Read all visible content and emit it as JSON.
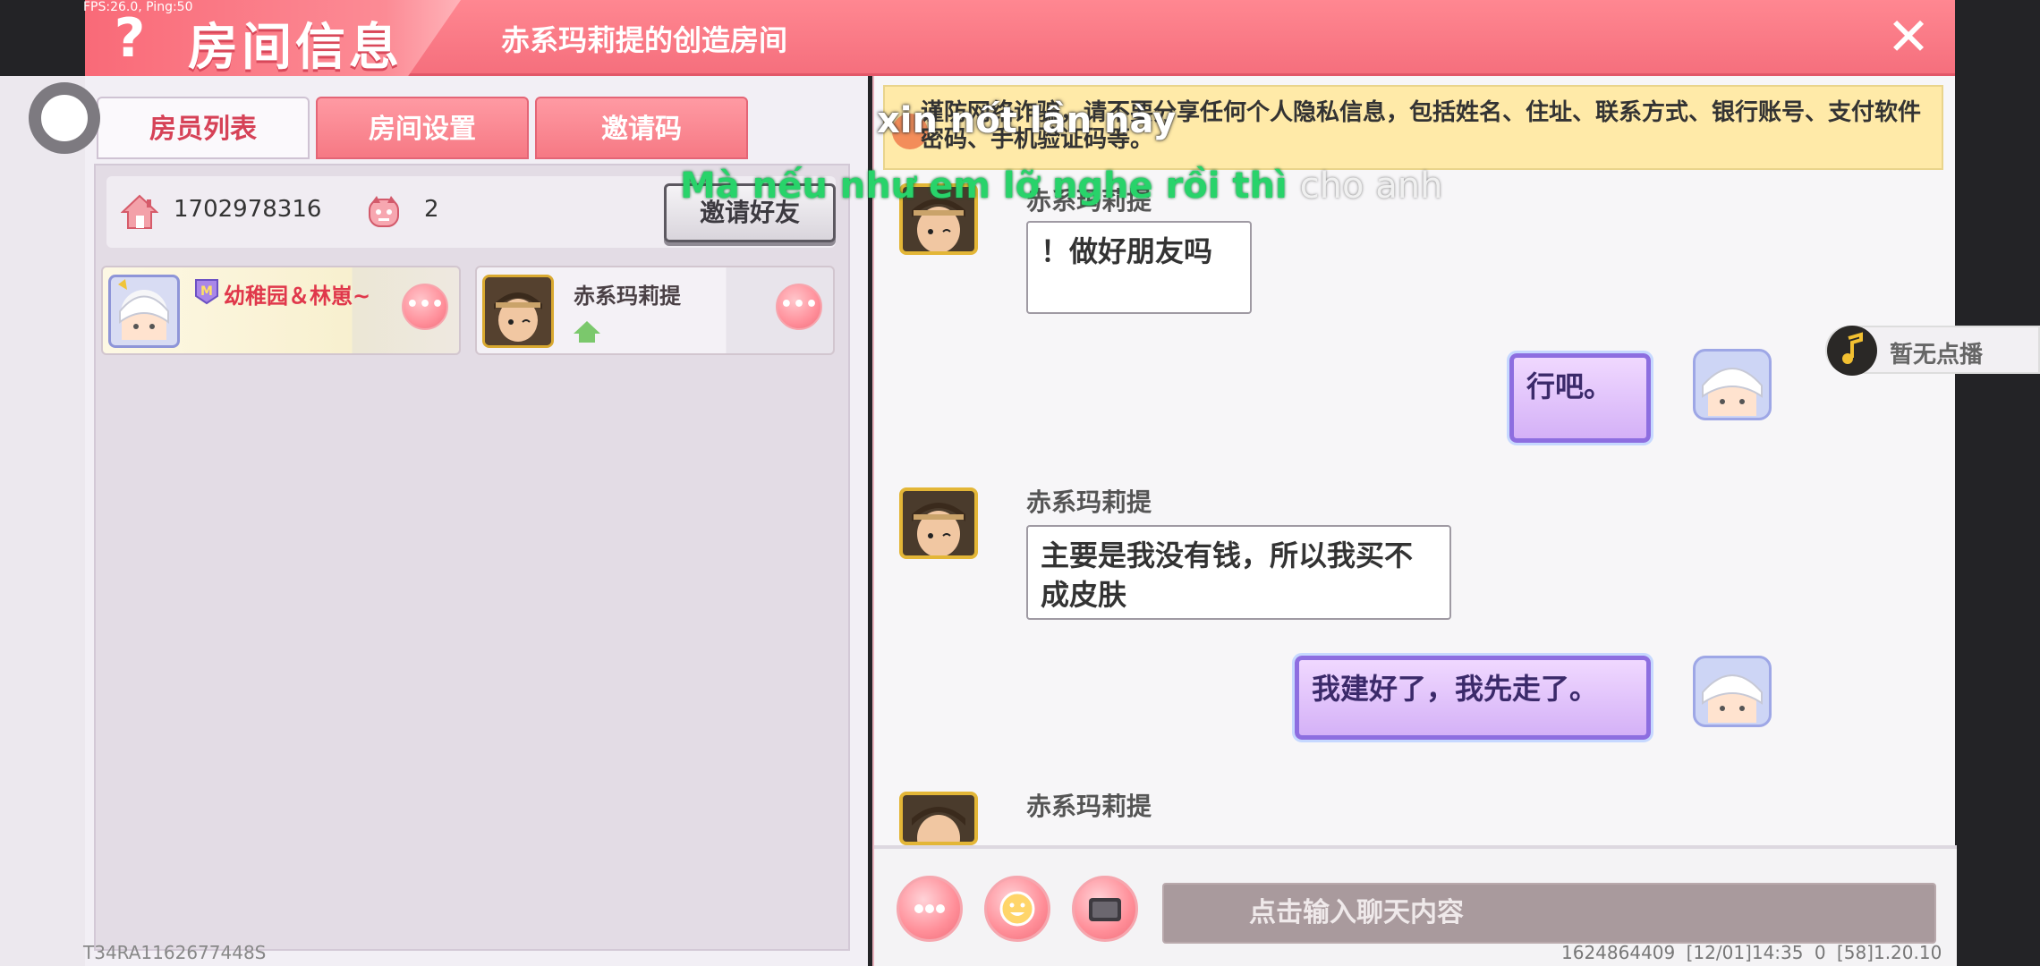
{
  "overlay": {
    "fps": "FPS:26.0, Ping:50"
  },
  "header": {
    "help_icon": "?",
    "title": "房间信息",
    "room_name": "赤系玛莉提的创造房间",
    "close_icon": "✕"
  },
  "tabs": [
    {
      "label": "房员列表",
      "active": true
    },
    {
      "label": "房间设置",
      "active": false
    },
    {
      "label": "邀请码",
      "active": false
    }
  ],
  "room_info": {
    "room_id": "1702978316",
    "member_count": "2",
    "invite_button": "邀请好友"
  },
  "members": [
    {
      "name": "幼稚园＆林崽~",
      "badge": "M"
    },
    {
      "name": "赤系玛莉提"
    }
  ],
  "chat": {
    "warning": "谨防网络诈骗，请不要分享任何个人隐私信息，包括姓名、住址、联系方式、银行账号、支付软件密码、手机验证码等。",
    "messages": [
      {
        "sender": "赤系玛莉提",
        "text": "！做好朋友吗",
        "self": false
      },
      {
        "text": "行吧。",
        "self": true
      },
      {
        "sender": "赤系玛莉提",
        "text": "主要是我没有钱，所以我买不成皮肤",
        "self": false
      },
      {
        "text": "我建好了，我先走了。",
        "self": true
      },
      {
        "sender": "赤系玛莉提",
        "self": false
      }
    ],
    "input_placeholder": "点击输入聊天内容"
  },
  "music": {
    "label": "暂无点播"
  },
  "subtitles": {
    "line1": "xin nốt lần này",
    "line2_main": "Mà nếu như em lỡ nghe rồi thì",
    "line2_faded": "cho anh"
  },
  "footer": {
    "device_id": "T34RA1162677448S",
    "info": "1624864409   [12/01]14:35 0   [58]1.20.10"
  },
  "colors": {
    "header": "#f56f7d",
    "self_bubble": "#d4b1f7",
    "subtitle_green": "#28d36a"
  }
}
